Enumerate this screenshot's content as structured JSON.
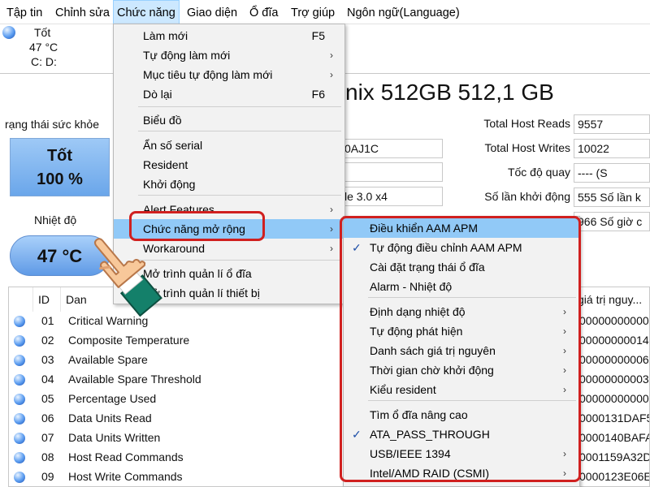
{
  "menubar": {
    "items": [
      "Tập tin",
      "Chỉnh sửa",
      "Chức năng",
      "Giao diện",
      "Ổ đĩa",
      "Trợ giúp",
      "Ngôn ngữ(Language)"
    ]
  },
  "disk_tab": {
    "status": "Tốt",
    "temp": "47 °C",
    "drives": "C: D:"
  },
  "drive_title": "nix 512GB 512,1 GB",
  "health": {
    "label": "rạng thái sức khỏe",
    "status": "Tốt",
    "percent": "100 %"
  },
  "temperature": {
    "label": "Nhiệt độ",
    "value": "47 °C"
  },
  "info_left_values": [
    "0AJ1C",
    "le 3.0 x4"
  ],
  "info_right": [
    {
      "label": "Total Host Reads",
      "value": "9557"
    },
    {
      "label": "Total Host Writes",
      "value": "10022"
    },
    {
      "label": "Tốc độ quay",
      "value": "---- (S"
    },
    {
      "label": "Số lần khởi động",
      "value": "555 Số lần k"
    },
    {
      "label": "",
      "value": "966 Số giờ c"
    }
  ],
  "table": {
    "headers": {
      "id": "ID",
      "name": "Dan",
      "raw": "giá trị nguy..."
    },
    "rows": [
      {
        "id": "01",
        "name": "Critical Warning",
        "raw": "000000000000"
      },
      {
        "id": "02",
        "name": "Composite Temperature",
        "raw": "00000000014"
      },
      {
        "id": "03",
        "name": "Available Spare",
        "raw": "00000000006"
      },
      {
        "id": "04",
        "name": "Available Spare Threshold",
        "raw": "00000000003"
      },
      {
        "id": "05",
        "name": "Percentage Used",
        "raw": "000000000000"
      },
      {
        "id": "06",
        "name": "Data Units Read",
        "raw": "0000131DAF5"
      },
      {
        "id": "07",
        "name": "Data Units Written",
        "raw": "0000140BAFA"
      },
      {
        "id": "08",
        "name": "Host Read Commands",
        "raw": "0001159A32D"
      },
      {
        "id": "09",
        "name": "Host Write Commands",
        "raw": "0000123E06E"
      }
    ]
  },
  "function_menu": {
    "items": [
      {
        "label": "Làm mới",
        "shortcut": "F5"
      },
      {
        "label": "Tự động làm mới",
        "submenu": true
      },
      {
        "label": "Mục tiêu tự động làm mới",
        "submenu": true
      },
      {
        "label": "Dò lại",
        "shortcut": "F6"
      },
      {
        "label": "Biểu đồ"
      },
      {
        "label": "Ẩn số serial"
      },
      {
        "label": "Resident"
      },
      {
        "label": "Khởi động"
      },
      {
        "label": "Alert Features",
        "submenu": true
      },
      {
        "label": "Chức năng mở rộng",
        "submenu": true,
        "highlighted": true
      },
      {
        "label": "Workaround",
        "submenu": true
      },
      {
        "label": "Mở trình quản lí ổ đĩa"
      },
      {
        "label": "Mở trình quản lí thiết bị"
      }
    ]
  },
  "extended_menu": {
    "items": [
      {
        "label": "Điều khiển AAM APM",
        "highlighted": true
      },
      {
        "label": "Tự động điều chỉnh AAM APM",
        "checked": true
      },
      {
        "label": "Cài đặt trạng thái ổ đĩa"
      },
      {
        "label": "Alarm - Nhiệt độ"
      },
      {
        "label": "Định dạng nhiệt độ",
        "submenu": true
      },
      {
        "label": "Tự động phát hiện",
        "submenu": true
      },
      {
        "label": "Danh sách giá trị nguyên",
        "submenu": true
      },
      {
        "label": "Thời gian chờ khởi động",
        "submenu": true
      },
      {
        "label": "Kiểu resident",
        "submenu": true
      },
      {
        "label": "Tìm ổ đĩa nâng cao"
      },
      {
        "label": "ATA_PASS_THROUGH",
        "checked": true
      },
      {
        "label": "USB/IEEE 1394",
        "submenu": true
      },
      {
        "label": "Intel/AMD RAID (CSMI)",
        "submenu": true
      }
    ]
  },
  "icons": {
    "submenu_arrow": "›",
    "check": "✓"
  },
  "colors": {
    "highlight": "#91c9f7",
    "annotation_red": "#d0201f",
    "menubar_active": "#cce8ff"
  }
}
